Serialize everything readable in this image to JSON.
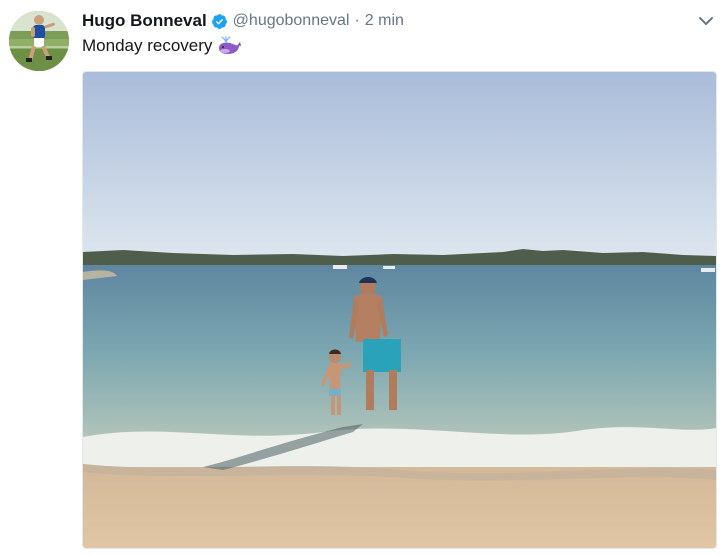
{
  "tweet": {
    "author_name": "Hugo Bonneval",
    "verified": true,
    "handle": "@hugobonneval",
    "separator": "·",
    "timestamp": "2 min",
    "text": "Monday recovery",
    "emoji": "whale-emoji",
    "avatar_icon": "player-avatar-photo",
    "menu_icon": "chevron-down-icon",
    "media_description_icon": "beach-photo"
  },
  "colors": {
    "name": "#14171a",
    "secondary": "#657786",
    "verified": "#1da1f2",
    "whale": "#8e5bc6"
  }
}
